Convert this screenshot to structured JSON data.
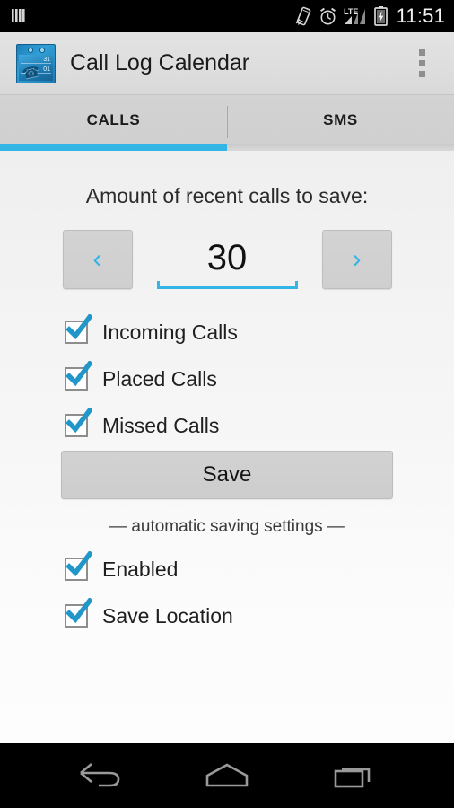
{
  "status_bar": {
    "icons": [
      "sim-card-icon",
      "vibrate-icon",
      "alarm-clock-icon",
      "lte-signal-icon",
      "battery-charging-icon"
    ],
    "network_label": "LTE",
    "time": "11:51"
  },
  "action_bar": {
    "app_icon_name": "call-log-calendar-app-icon",
    "app_icon_day_top": "31",
    "app_icon_day_bottom": "01",
    "title": "Call Log Calendar",
    "overflow_label": "⋮"
  },
  "tabs": {
    "items": [
      {
        "label": "CALLS",
        "active": true
      },
      {
        "label": "SMS",
        "active": false
      }
    ],
    "indicator_color": "#33b5e5"
  },
  "main": {
    "amount_label": "Amount of recent calls to save:",
    "stepper": {
      "decrement_label": "‹",
      "value": "30",
      "increment_label": "›",
      "accent_color": "#33b5e5"
    },
    "call_type_checkboxes": [
      {
        "label": "Incoming Calls",
        "checked": true
      },
      {
        "label": "Placed Calls",
        "checked": true
      },
      {
        "label": "Missed Calls",
        "checked": true
      }
    ],
    "save_button_label": "Save",
    "auto_section_label": "— automatic saving settings —",
    "auto_checkboxes": [
      {
        "label": "Enabled",
        "checked": true
      },
      {
        "label": "Save Location",
        "checked": true
      }
    ]
  },
  "nav_bar": {
    "buttons": [
      {
        "name": "back-button",
        "icon": "back-arrow-icon"
      },
      {
        "name": "home-button",
        "icon": "home-icon"
      },
      {
        "name": "recents-button",
        "icon": "recent-apps-icon"
      }
    ]
  },
  "colors": {
    "accent": "#33b5e5",
    "action_bar_bg": "#dedede",
    "tab_bar_bg": "#d1d1d1",
    "content_bg": "#f6f6f6",
    "system_bar_bg": "#000000"
  }
}
